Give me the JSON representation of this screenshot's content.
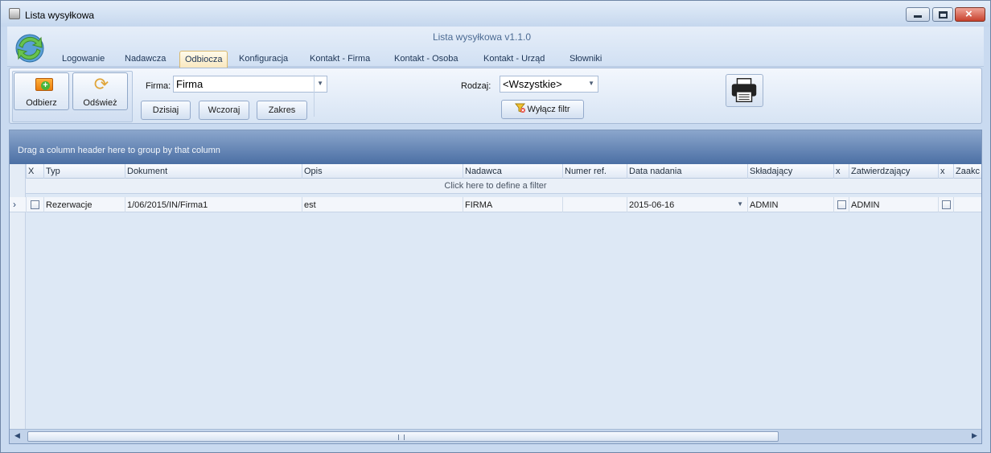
{
  "window": {
    "title": "Lista wysyłkowa"
  },
  "app": {
    "title": "Lista wysyłkowa v1.1.0"
  },
  "tabs": [
    {
      "label": "Logowanie",
      "active": false
    },
    {
      "label": "Nadawcza",
      "active": false
    },
    {
      "label": "Odbiocza",
      "active": true
    },
    {
      "label": "Konfiguracja",
      "active": false
    },
    {
      "label": "Kontakt - Firma",
      "active": false
    },
    {
      "label": "Kontakt - Osoba",
      "active": false
    },
    {
      "label": "Kontakt - Urząd",
      "active": false
    },
    {
      "label": "Słowniki",
      "active": false
    }
  ],
  "toolbar": {
    "receive_label": "Odbierz",
    "refresh_label": "Odśwież",
    "firma_label": "Firma:",
    "firma_value": "Firma",
    "rodzaj_label": "Rodzaj:",
    "rodzaj_value": "<Wszystkie>",
    "today_label": "Dzisiaj",
    "yesterday_label": "Wczoraj",
    "range_label": "Zakres",
    "clear_filter_label": "Wyłącz filtr"
  },
  "grid": {
    "group_hint": "Drag a column header here to group by that column",
    "filter_hint": "Click here to define a filter",
    "columns": [
      "X",
      "Typ",
      "Dokument",
      "Opis",
      "Nadawca",
      "Numer ref.",
      "Data nadania",
      "Składający",
      "x",
      "Zatwierdzający",
      "x",
      "Zaakc"
    ],
    "rows": [
      {
        "checked": false,
        "typ": "Rezerwacje",
        "dokument": "1/06/2015/IN/Firma1",
        "opis": "est",
        "nadawca": "FIRMA",
        "numer_ref": "",
        "data_nadania": "2015-06-16",
        "skladajacy": "ADMIN",
        "skladajacy_x": false,
        "zatwierdzajacy": "ADMIN",
        "zatwierdzajacy_x": false
      }
    ]
  },
  "colors": {
    "group_panel": "#4b6fa4",
    "active_tab": "#f9e8c0",
    "window_bg": "#c9daf0"
  }
}
